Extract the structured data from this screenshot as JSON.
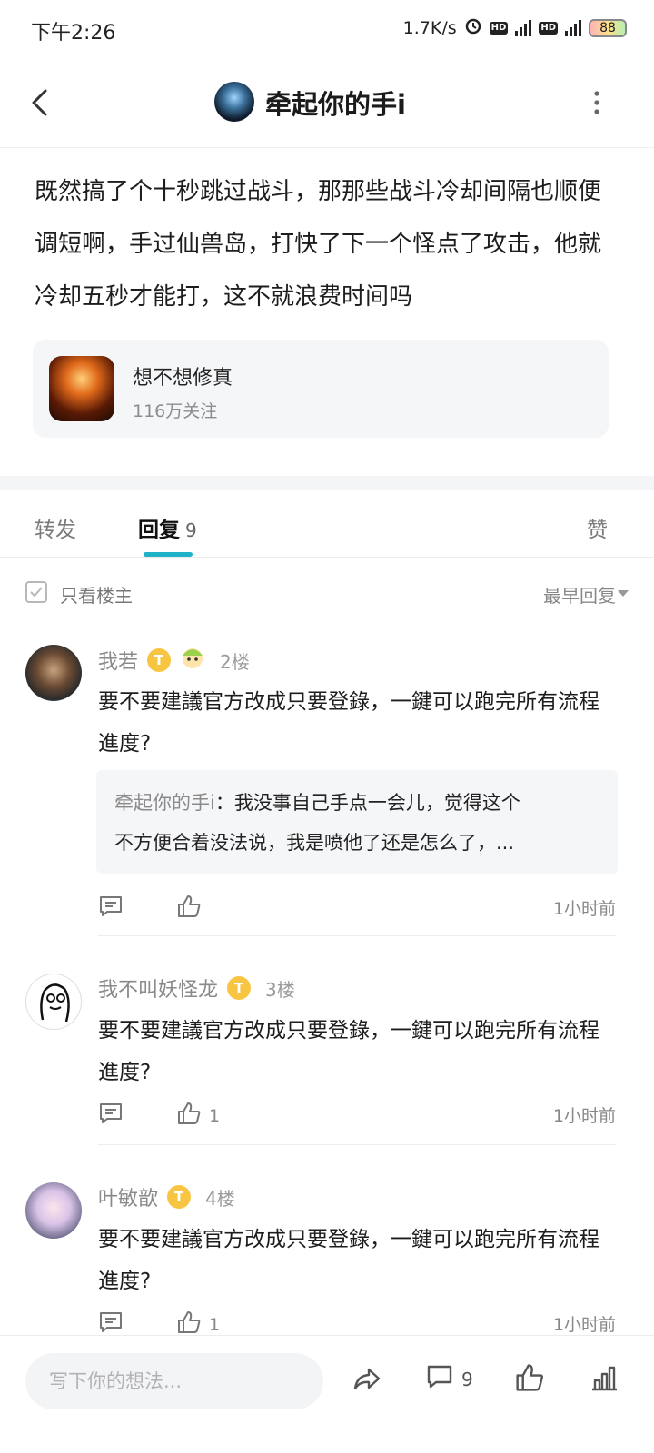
{
  "status": {
    "time": "下午2:26",
    "speed": "1.7K/s",
    "battery": "88",
    "hd1": "HD",
    "hd2": "HD",
    "net": "4G"
  },
  "header": {
    "title": "牵起你的手i"
  },
  "post": {
    "content": "既然搞了个十秒跳过战斗，那那些战斗冷却间隔也顺便调短啊，手过仙兽岛，打快了下一个怪点了攻击，他就冷却五秒才能打，这不就浪费时间吗"
  },
  "card": {
    "name": "想不想修真",
    "followers": "116万关注"
  },
  "tabs": {
    "repost": "转发",
    "reply": "回复",
    "reply_count": "9",
    "like": "赞"
  },
  "filter": {
    "only_op": "只看楼主",
    "sort": "最早回复"
  },
  "comments": [
    {
      "name": "我若",
      "badge": "T",
      "floor": "2楼",
      "text": "要不要建議官方改成只要登錄，一鍵可以跑完所有流程進度?",
      "quote_name": "牵起你的手i",
      "quote_sep": "：",
      "quote_line1": "我没事自己手点一会儿，觉得这个",
      "quote_line2": "不方便合着没法说，我是喷他了还是怎么了，...",
      "likes": "",
      "time": "1小时前"
    },
    {
      "name": "我不叫妖怪龙",
      "badge": "T",
      "floor": "3楼",
      "text": "要不要建議官方改成只要登錄，一鍵可以跑完所有流程進度?",
      "likes": "1",
      "time": "1小时前"
    },
    {
      "name": "叶敏歆",
      "badge": "T",
      "floor": "4楼",
      "text": "要不要建議官方改成只要登錄，一鍵可以跑完所有流程進度?",
      "likes": "1",
      "time": "1小时前"
    }
  ],
  "bottom": {
    "placeholder": "写下你的想法...",
    "comment_count": "9"
  },
  "colors": {
    "accent": "#1fb2c7",
    "badge": "#f7c542",
    "card_bg": "#f5f6f8"
  }
}
